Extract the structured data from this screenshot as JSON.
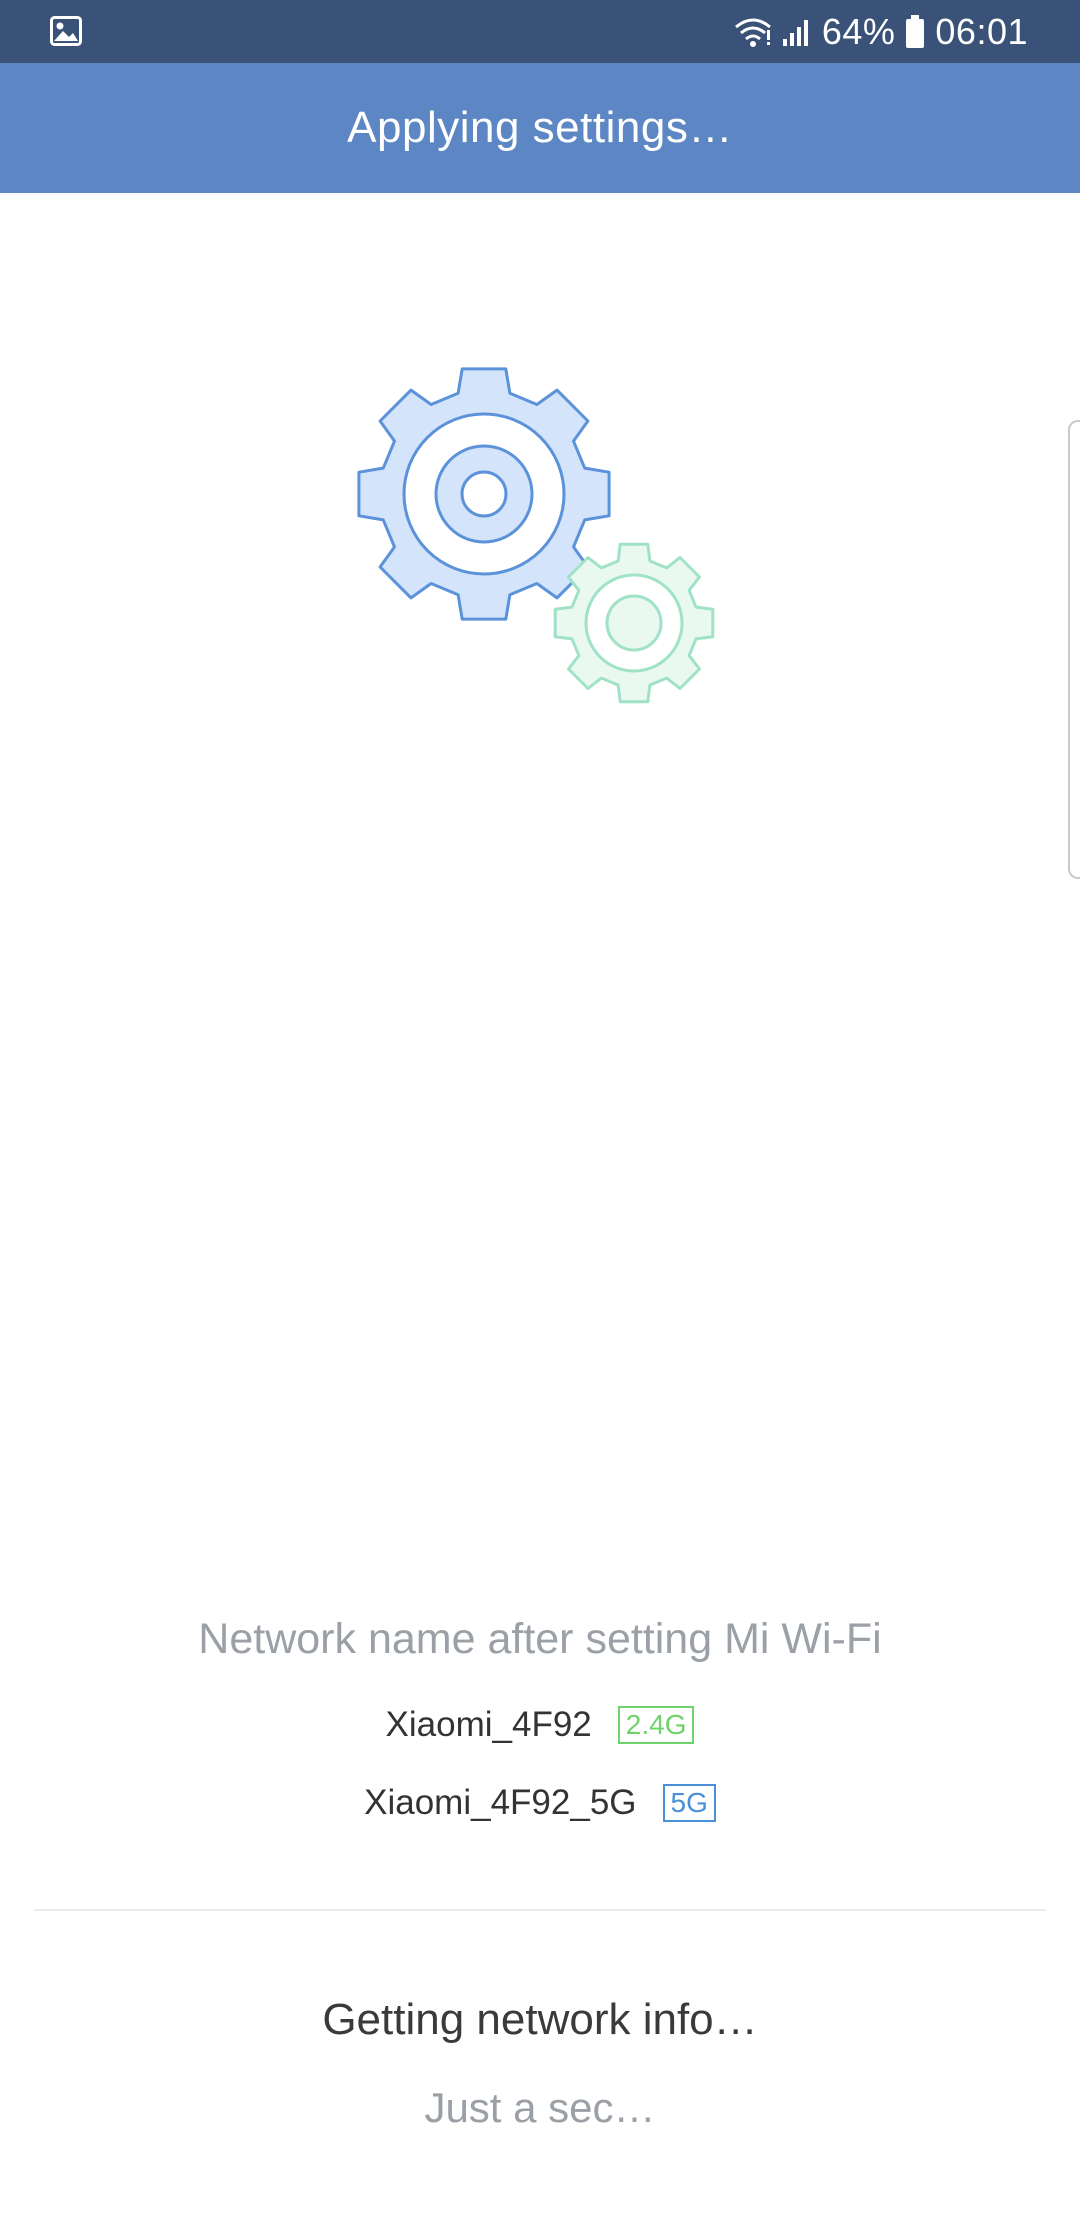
{
  "status_bar": {
    "left_icon": "image-icon",
    "battery_percent": "64%",
    "time": "06:01",
    "icons": [
      "wifi-icon",
      "signal-icon",
      "battery-icon"
    ]
  },
  "header": {
    "title": "Applying settings…"
  },
  "illustration": {
    "name": "gears-illustration",
    "colors": {
      "large_gear_fill": "#d3e4fb",
      "large_gear_stroke": "#5b92d9",
      "small_gear_fill": "#e9f9f2",
      "small_gear_stroke": "#9fe2c5"
    }
  },
  "network": {
    "heading": "Network name after setting Mi Wi-Fi",
    "networks": [
      {
        "name": "Xiaomi_4F92",
        "band": "2.4G",
        "band_color": "#6ed36a"
      },
      {
        "name": "Xiaomi_4F92_5G",
        "band": "5G",
        "band_color": "#4a8fd8"
      }
    ]
  },
  "progress": {
    "title": "Getting network info…",
    "subtitle": "Just a sec…"
  },
  "colors": {
    "status_bar": "#3b5278",
    "title_bar": "#5d87c4"
  }
}
